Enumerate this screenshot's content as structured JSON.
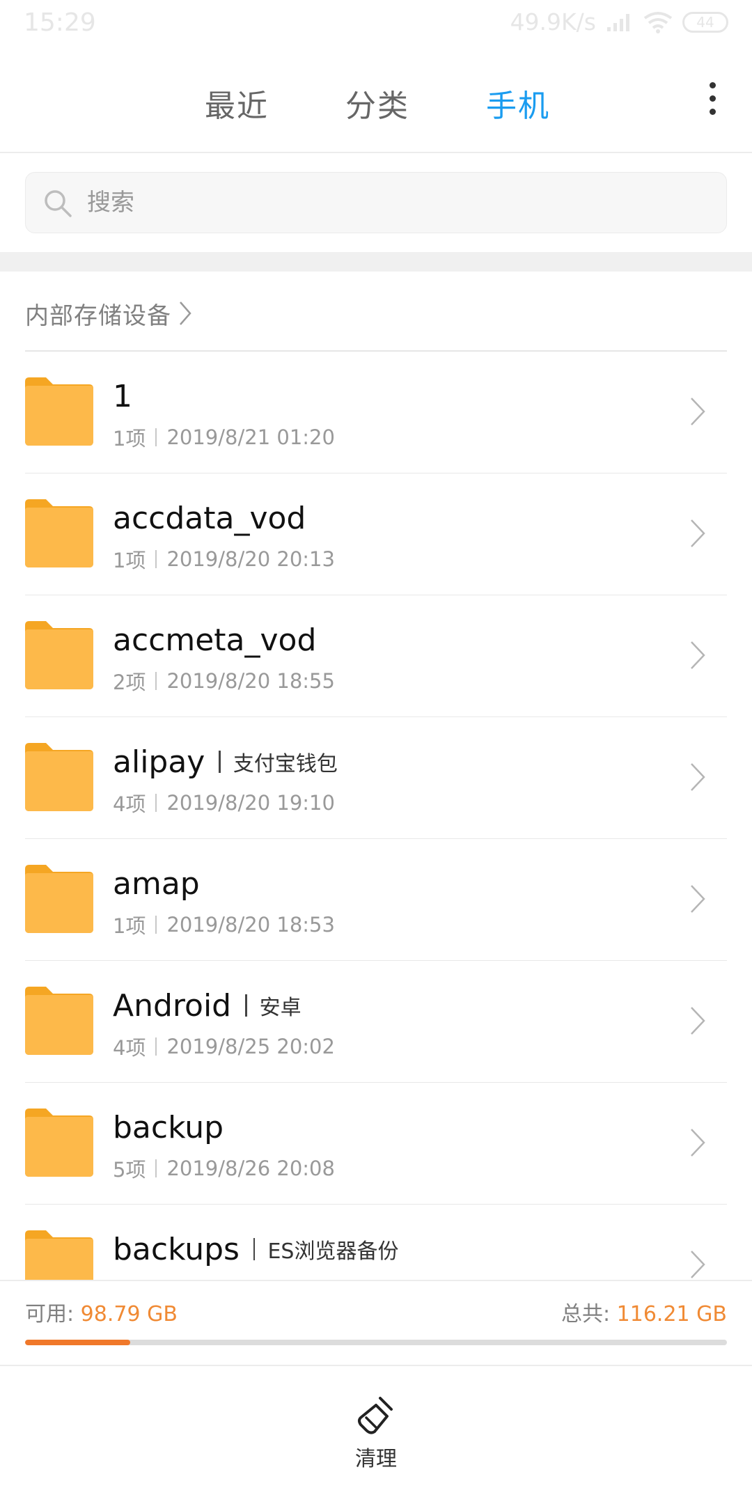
{
  "status_bar": {
    "time": "15:29",
    "net_speed": "49.9K/s",
    "battery": "44"
  },
  "tabs": [
    {
      "label": "最近",
      "active": false
    },
    {
      "label": "分类",
      "active": false
    },
    {
      "label": "手机",
      "active": true
    }
  ],
  "search": {
    "placeholder": "搜索"
  },
  "breadcrumb": {
    "label": "内部存储设备"
  },
  "files": [
    {
      "name": "1",
      "alias": "",
      "count": "1项",
      "date": "2019/8/21 01:20"
    },
    {
      "name": "accdata_vod",
      "alias": "",
      "count": "1项",
      "date": "2019/8/20 20:13"
    },
    {
      "name": "accmeta_vod",
      "alias": "",
      "count": "2项",
      "date": "2019/8/20 18:55"
    },
    {
      "name": "alipay",
      "alias": "支付宝钱包",
      "count": "4项",
      "date": "2019/8/20 19:10"
    },
    {
      "name": "amap",
      "alias": "",
      "count": "1项",
      "date": "2019/8/20 18:53"
    },
    {
      "name": "Android",
      "alias": "安卓",
      "count": "4项",
      "date": "2019/8/25 20:02"
    },
    {
      "name": "backup",
      "alias": "",
      "count": "5项",
      "date": "2019/8/26 20:08"
    },
    {
      "name": "backups",
      "alias": "ES浏览器备份",
      "count": "",
      "date": ""
    }
  ],
  "storage": {
    "free_label": "可用:",
    "free_value": "98.79 GB",
    "total_label": "总共:",
    "total_value": "116.21 GB",
    "used_fraction": 0.15
  },
  "bottom": {
    "clean_label": "清理"
  },
  "colors": {
    "accent": "#1a9cf0",
    "folder": "#fdb94a",
    "storage_highlight": "#f08a34"
  }
}
